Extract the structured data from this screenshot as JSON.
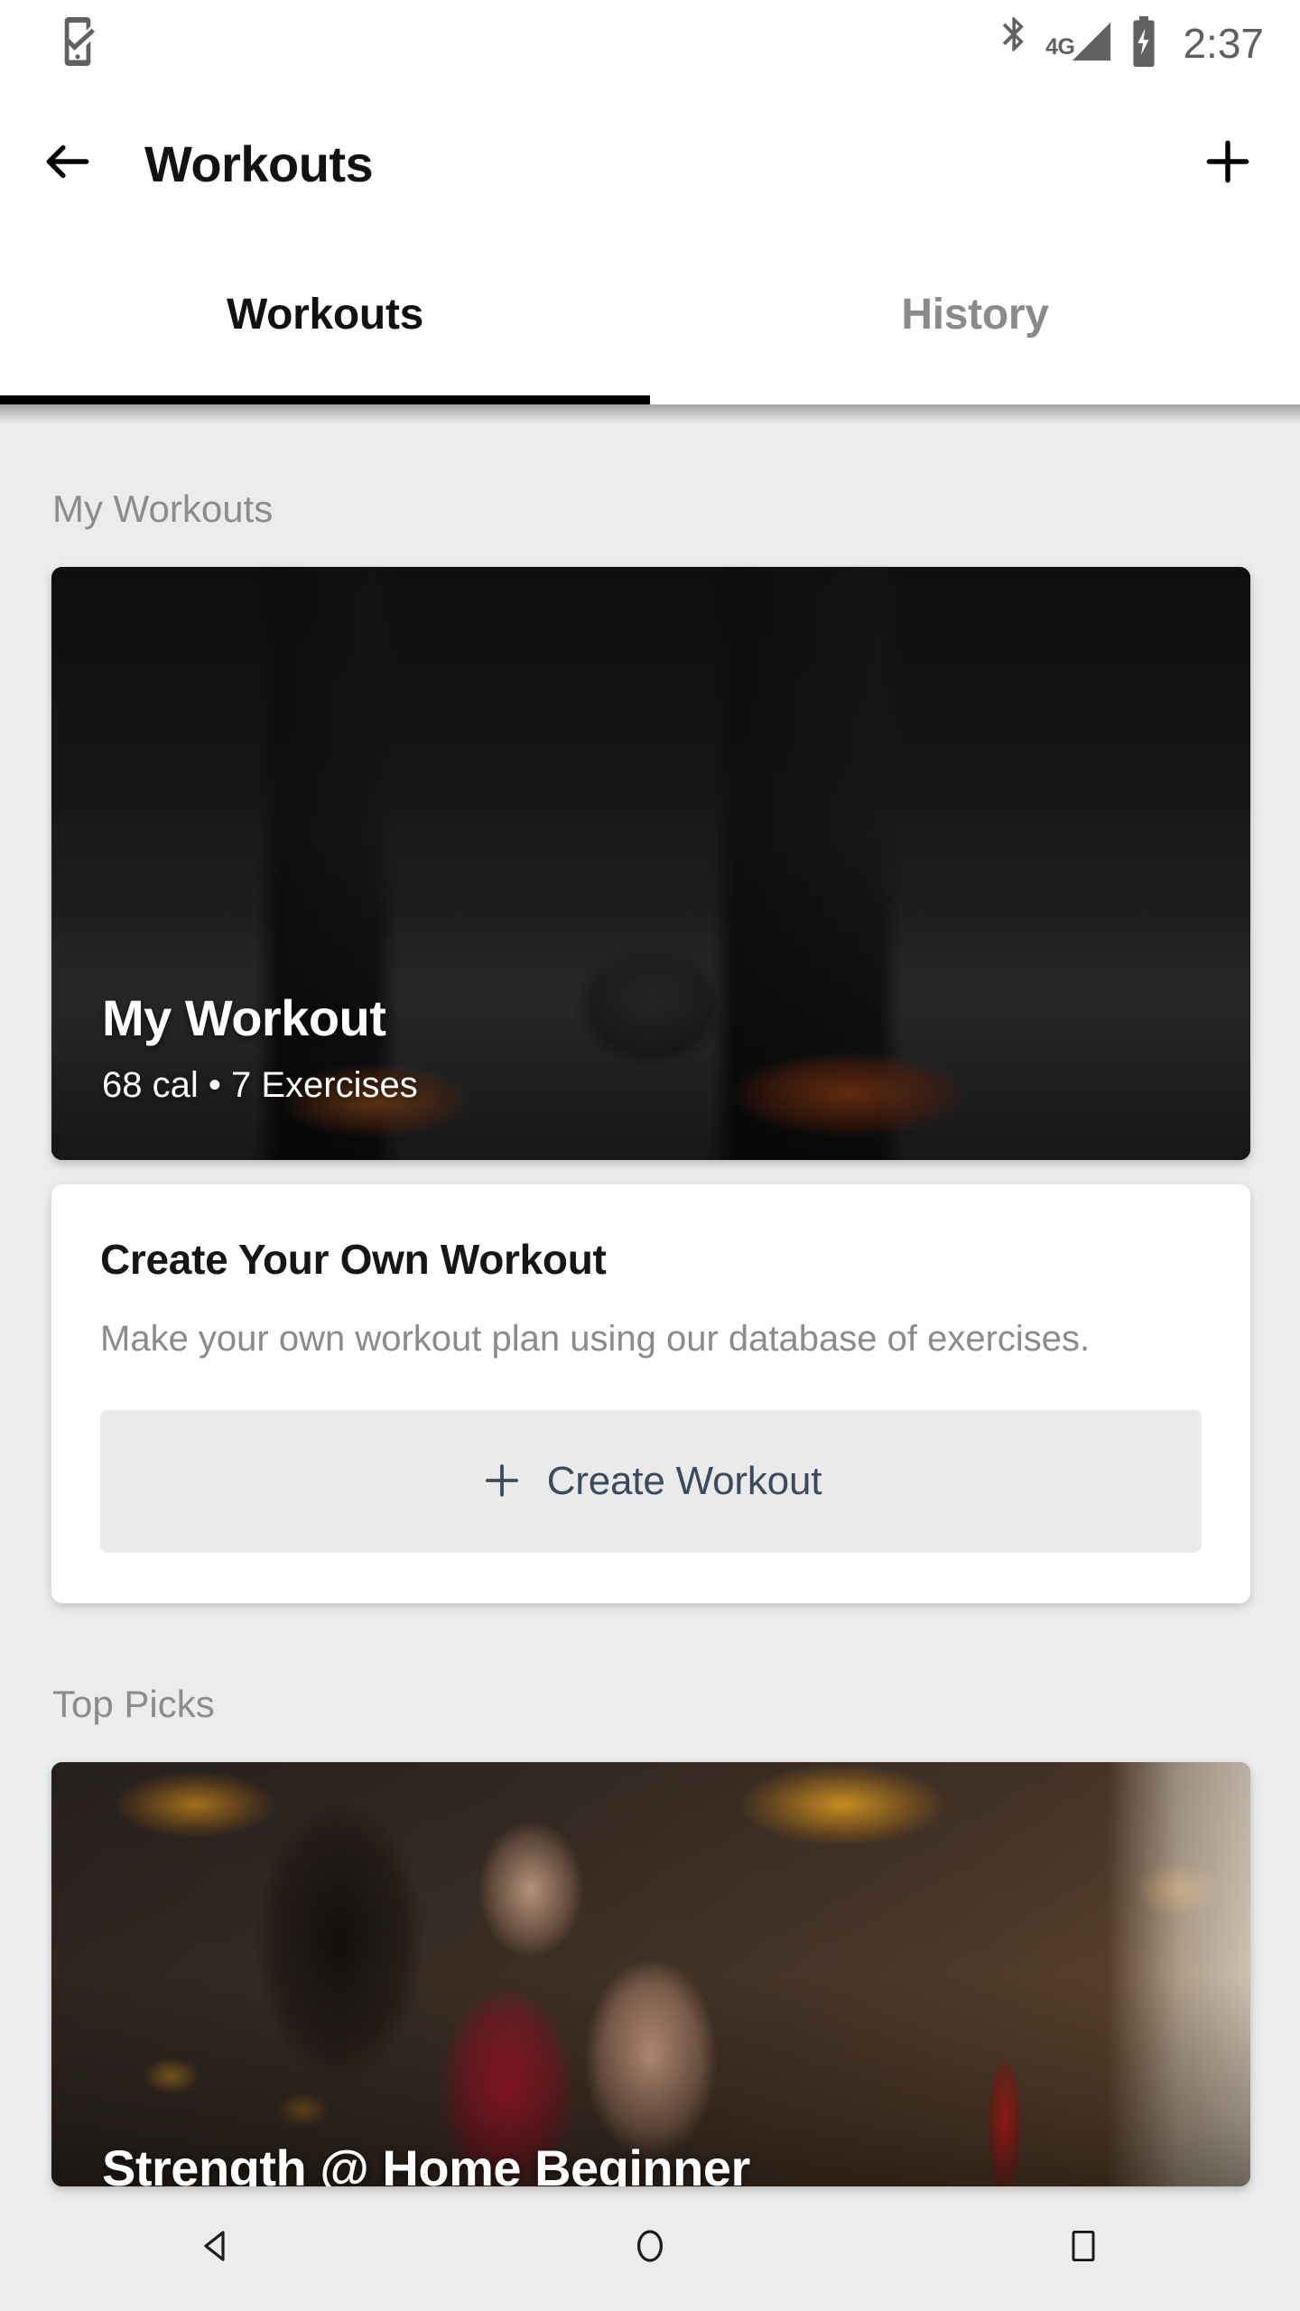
{
  "status_bar": {
    "notification_icon": "phone-check-icon",
    "bluetooth_icon": "bluetooth-icon",
    "network_label": "4G",
    "signal_icon": "signal-bars-icon",
    "battery_icon": "battery-charging-icon",
    "time": "2:37"
  },
  "app_bar": {
    "back_icon": "back-arrow-icon",
    "title": "Workouts",
    "add_icon": "plus-icon"
  },
  "tabs": [
    {
      "label": "Workouts",
      "active": true
    },
    {
      "label": "History",
      "active": false
    }
  ],
  "sections": {
    "my_workouts": {
      "title": "My Workouts",
      "card": {
        "title": "My Workout",
        "subtitle": "68 cal • 7 Exercises"
      },
      "create_card": {
        "title": "Create Your Own Workout",
        "description": "Make your own workout plan using our database of exercises.",
        "button_label": "Create Workout",
        "button_icon": "plus-icon"
      }
    },
    "top_picks": {
      "title": "Top Picks",
      "card": {
        "title": "Strength @ Home Beginner"
      }
    }
  },
  "nav_bar": {
    "back_label": "back-triangle-icon",
    "home_label": "home-circle-icon",
    "recents_label": "recents-square-icon"
  },
  "colors": {
    "page_background": "#ececec",
    "surface": "#ffffff",
    "primary_text": "#121212",
    "secondary_text": "#8c8c8c",
    "tab_indicator": "#000000",
    "button_background": "#eaeaea",
    "button_text": "#3c4b5c"
  }
}
